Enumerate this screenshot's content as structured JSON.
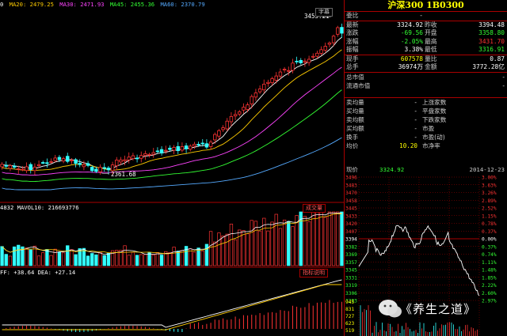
{
  "ma_bar": {
    "items": [
      {
        "label": "0",
        "color": "#ffffff"
      },
      {
        "label": "MA20: 2479.25",
        "color": "#ffcc00"
      },
      {
        "label": "MA30: 2471.93",
        "color": "#ff44ff"
      },
      {
        "label": "MA45: 2455.36",
        "color": "#33ff33"
      },
      {
        "label": "MA60: 2370.79",
        "color": "#55aaff"
      }
    ]
  },
  "price_chart": {
    "high_label": "3455.21",
    "low_label": "2361.68",
    "top_right_badge": "字幕"
  },
  "volume_panel": {
    "header": "4832  MAVOL10: 216693776",
    "tag": "成交量"
  },
  "macd_panel": {
    "header": "FF: +38.64  DEA: +27.14",
    "tag": "指标说明"
  },
  "quote": {
    "title": "沪深300 1B0300",
    "commission_label": "委比",
    "commission_value": "-",
    "rows": [
      {
        "l1": "最新",
        "v1": "3324.92",
        "c1": "#ffffff",
        "l2": "昨收",
        "v2": "3394.48",
        "c2": "#ffffff"
      },
      {
        "l1": "涨跌",
        "v1": "-69.56",
        "c1": "#33ff33",
        "l2": "开盘",
        "v2": "3358.80",
        "c2": "#33ff33"
      },
      {
        "l1": "涨幅",
        "v1": "-2.05%",
        "c1": "#33ff33",
        "l2": "最高",
        "v2": "3431.70",
        "c2": "#ff3333"
      },
      {
        "l1": "振幅",
        "v1": "3.38%",
        "c1": "#ffffff",
        "l2": "最低",
        "v2": "3316.91",
        "c2": "#33ff33"
      }
    ],
    "rows2": [
      {
        "l1": "现手",
        "v1": "607578",
        "c1": "#ffff00",
        "l2": "量比",
        "v2": "0.87",
        "c2": "#ffffff"
      },
      {
        "l1": "总手",
        "v1": "36974万",
        "c1": "#ffffff",
        "l2": "金额",
        "v2": "3772.28亿",
        "c2": "#ffffff"
      }
    ],
    "cap_rows": [
      {
        "label": "总市值",
        "value": "-"
      },
      {
        "label": "流通市值",
        "value": "-"
      }
    ],
    "stats": [
      {
        "l1": "卖均量",
        "v1": "-",
        "l2": "上涨家数"
      },
      {
        "l1": "买均量",
        "v1": "-",
        "l2": "平盘家数"
      },
      {
        "l1": "卖均额",
        "v1": "-",
        "l2": "下跌家数"
      },
      {
        "l1": "买均额",
        "v1": "-",
        "l2": "市盈"
      },
      {
        "l1": "换手",
        "v1": "-",
        "l2": "市盈(动)"
      },
      {
        "l1": "均价",
        "v1": "10.20",
        "l2": "市净率"
      }
    ]
  },
  "intraday": {
    "now_label": "现价",
    "now_value": "3324.92",
    "date": "2014-12-23",
    "price_ticks": [
      "3496",
      "3483",
      "3470",
      "3458",
      "3445",
      "3433",
      "3420",
      "3407",
      "3394",
      "3382",
      "3369",
      "3357",
      "3345",
      "3331",
      "3319",
      "3306",
      "3293"
    ],
    "pct_ticks": [
      "3.00%",
      "3.63%",
      "3.26%",
      "2.89%",
      "2.52%",
      "1.15%",
      "0.78%",
      "0.37%",
      "0.00%",
      "0.37%",
      "0.74%",
      "1.11%",
      "1.48%",
      "1.85%",
      "2.22%",
      "2.60%",
      "2.97%"
    ],
    "vol_ticks": [
      "945",
      "831",
      "727",
      "623",
      "519"
    ],
    "prev_close_line": "3394"
  },
  "watermark_text": "《养生之道》",
  "colors": {
    "up": "#ff3333",
    "down": "#33ffff",
    "grid": "#aa0000"
  }
}
